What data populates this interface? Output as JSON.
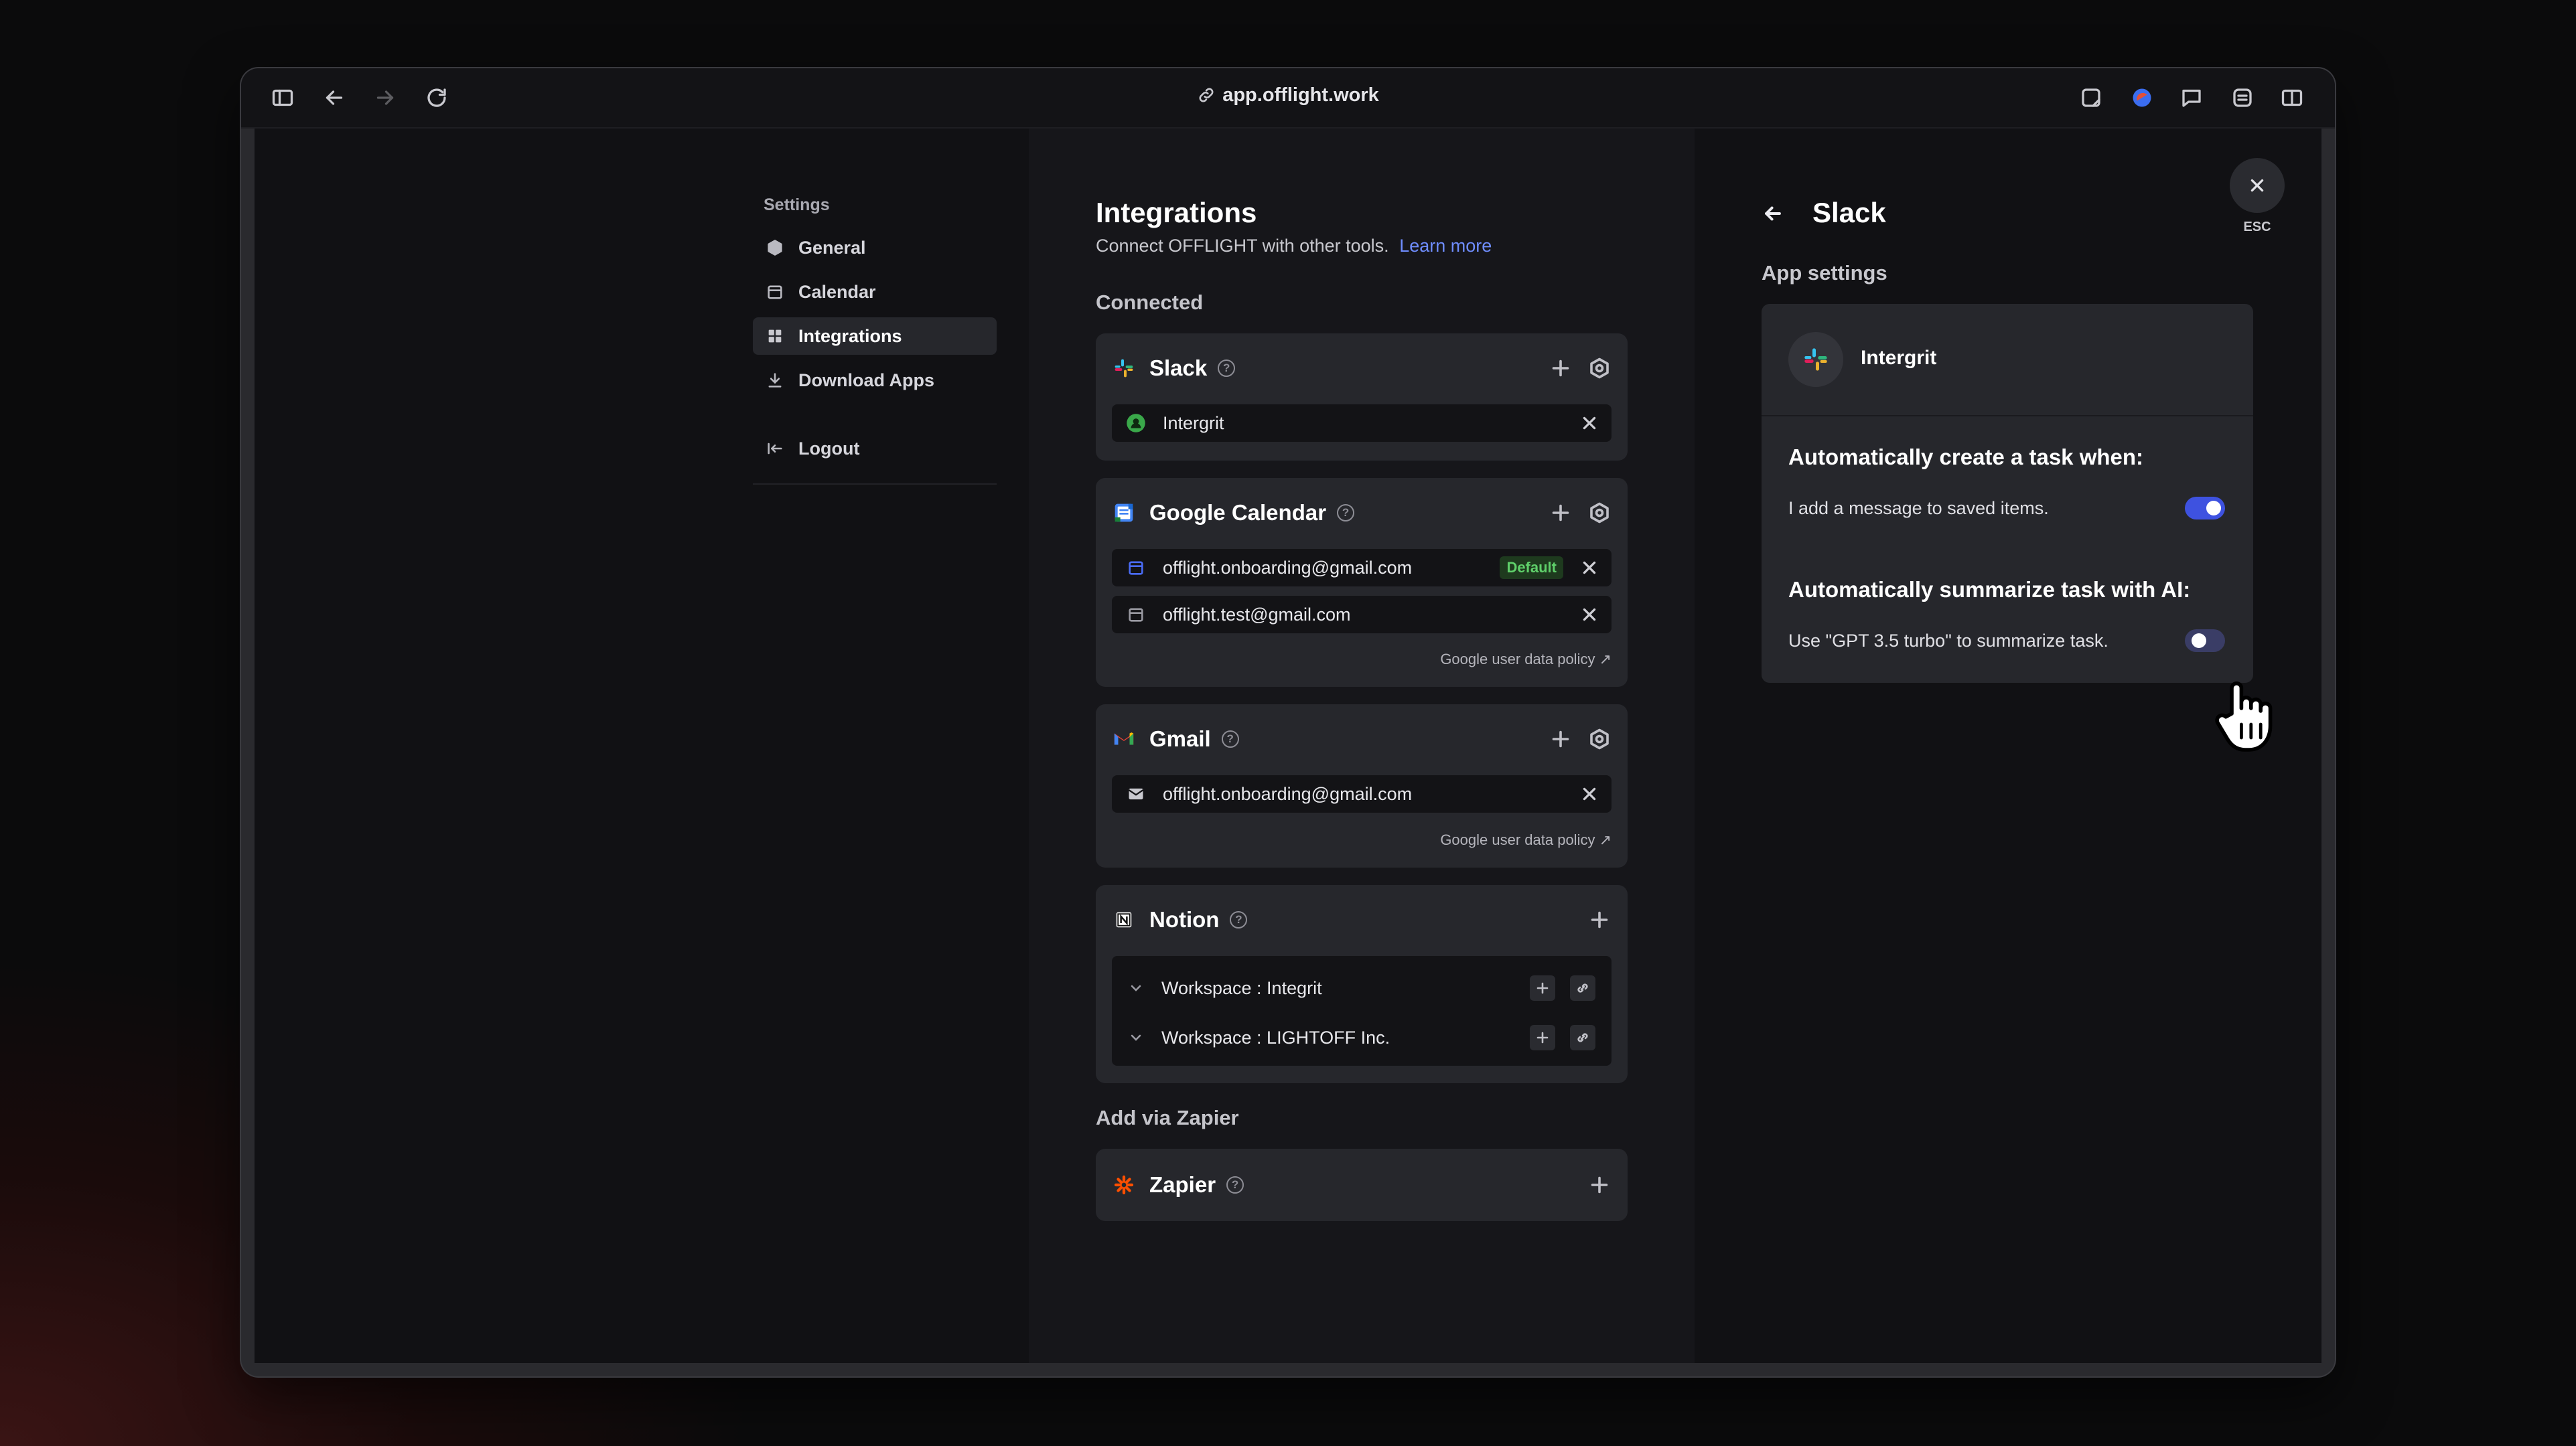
{
  "browser": {
    "url": "app.offlight.work"
  },
  "sidebar": {
    "heading": "Settings",
    "items": [
      {
        "label": "General",
        "icon": "hexagon-icon"
      },
      {
        "label": "Calendar",
        "icon": "calendar-icon"
      },
      {
        "label": "Integrations",
        "icon": "grid-icon",
        "active": true
      },
      {
        "label": "Download Apps",
        "icon": "download-icon"
      }
    ],
    "logout": "Logout"
  },
  "integrations": {
    "title": "Integrations",
    "subtitle": "Connect OFFLIGHT with other tools.",
    "learn_more": "Learn more",
    "connected_label": "Connected",
    "slack": {
      "name": "Slack",
      "accounts": [
        "Intergrit"
      ]
    },
    "google_calendar": {
      "name": "Google Calendar",
      "accounts": [
        "offlight.onboarding@gmail.com",
        "offlight.test@gmail.com"
      ],
      "default_badge": "Default",
      "policy": "Google user data policy ↗"
    },
    "gmail": {
      "name": "Gmail",
      "accounts": [
        "offlight.onboarding@gmail.com"
      ],
      "policy": "Google user data policy ↗"
    },
    "notion": {
      "name": "Notion",
      "workspaces": [
        "Workspace : Integrit",
        "Workspace : LIGHTOFF Inc."
      ]
    },
    "zapier_label": "Add via Zapier",
    "zapier": {
      "name": "Zapier"
    }
  },
  "app_settings": {
    "title": "Slack",
    "esc": "ESC",
    "section": "App settings",
    "workspace": "Intergrit",
    "create_task_heading": "Automatically create a task when:",
    "create_task_option": "I add a message to saved items.",
    "create_task_enabled": true,
    "summarize_heading": "Automatically summarize task with AI:",
    "summarize_option": "Use \"GPT 3.5 turbo\" to summarize task.",
    "summarize_enabled": false
  },
  "colors": {
    "accent": "#3e52e0",
    "link": "#6f8dff",
    "default_badge": "#5fd06a"
  }
}
